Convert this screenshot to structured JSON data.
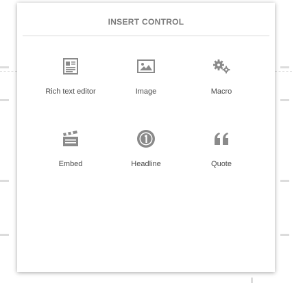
{
  "dialog": {
    "title": "INSERT CONTROL"
  },
  "controls": [
    {
      "label": "Rich text editor",
      "icon": "rich-text-editor-icon"
    },
    {
      "label": "Image",
      "icon": "image-icon"
    },
    {
      "label": "Macro",
      "icon": "gears-icon"
    },
    {
      "label": "Embed",
      "icon": "clapperboard-icon"
    },
    {
      "label": "Headline",
      "icon": "number-one-icon"
    },
    {
      "label": "Quote",
      "icon": "quote-icon"
    }
  ],
  "colors": {
    "icon": "#8a8a8a",
    "title": "#7a7a7a",
    "label": "#4a4a4a",
    "divider": "#d8d8d8"
  }
}
